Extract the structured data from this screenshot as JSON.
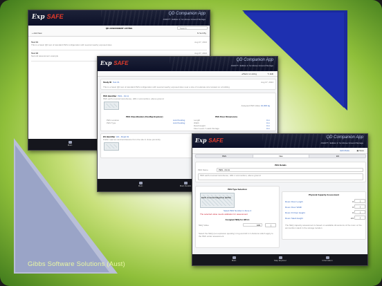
{
  "colors": {
    "accent_blue": "#3467c2",
    "header_navy": "#0c1028",
    "brand_red": "#e23b2b",
    "triangle_blue": "#1e30b0",
    "triangle_gray": "#9aa4c7"
  },
  "branding": {
    "logo_exp": "Exp",
    "logo_safe": "SAFE",
    "app_name": "QD Companion App",
    "app_subtitle": "AS2377 / Edition 2: for Above Ground Storage",
    "company": "Gibbs Software Solutions (Aust)"
  },
  "shot1": {
    "toolbar_title": "QD ASSESSMENT LISTING",
    "search_placeholder": "Search",
    "add_label": "Add New",
    "sort_label": "Sort By",
    "rows": [
      {
        "title": "Test 01",
        "meta": "Aug 07, 2024",
        "desc": "This is a basic QD test of standard PES configuration with several nearby exposed sites"
      },
      {
        "title": "Test 02",
        "meta": "Aug 07, 2024",
        "desc": "Second assessment example"
      }
    ],
    "tab_main": "Main"
  },
  "shot2": {
    "back_label": "Back to Listing",
    "edit_label": "Edit",
    "name_label": "Study ID",
    "name_value": "Test 01",
    "date": "Aug 07, 2024",
    "desc": "This is a basic QD test of standard PES configuration with several nearby exposed sites near a site of moderate size located on a building",
    "pes_label": "PES Identifier",
    "pes_value": "PES - 01.11",
    "pes_desc": "PES earth-covered storehouse, HD1.1 ammunition, above ground",
    "ammo_label": "Assigned PES Value",
    "ammo_value": "10,000 kg",
    "left_title": "PES Classification (Via Map Explorer)",
    "right_title": "PES Floor Dimensions",
    "left_rows": [
      "PES Location",
      "PES Type"
    ],
    "left_vals": [
      "Link Pending",
      "Link Pending"
    ],
    "right_rows": [
      "Length",
      "Width",
      "Dwell Height",
      "Floor Level / Loads Storage"
    ],
    "right_vals": [
      "0 m",
      "0 m",
      "0 m",
      "0 m"
    ],
    "es_label": "ES Identifier",
    "es_value": "ES - Road 01",
    "es_desc": "Public road at nominal distance from the site in close proximity",
    "tab_main": "Main",
    "tab_settings": "Main Details"
  },
  "shot3": {
    "back_label": "Edit Mode",
    "save_label": "Save",
    "tabs": [
      "PES",
      "Nes",
      "ES"
    ],
    "pes_details": "PES Details",
    "pes_name_label": "PES Name",
    "pes_name_value": "PES - 01.11",
    "pes_desc": "PES earth-covered storehouse, HD1.1 ammunition, above ground",
    "type_panel": "PES Type Selection",
    "type_value": "Earth Covered Magazine (ECM)",
    "type_note": "Select PES Number in Zone 4",
    "type_warn": "The selected value needs validation for assessment",
    "cap_title": "Assigned NEQ for HD1.1",
    "cap_label": "NEQ Value",
    "cap_value": "100",
    "cap_note": "Select the NEQ (net explosive quantity) in kg and HD 1.1 divisions which apply to the PES under assessment",
    "phys_title": "Physical Capacity Assessment",
    "phys_rows": [
      "Room Floor Length",
      "Room Floor Width",
      "Room Ft Floor Height",
      "Room Stack Height"
    ],
    "phys_vals": [
      "0",
      "0",
      "0",
      "2.0"
    ],
    "phys_note": "The NEQ capacity assessment is based on available dimensions of the room or the ammunition stack in the storage location",
    "tab_main": "Main",
    "tab_map": "Map Explorer",
    "tab_info": "Information"
  }
}
